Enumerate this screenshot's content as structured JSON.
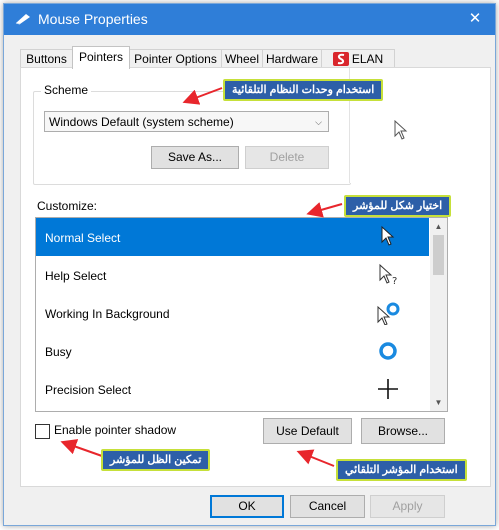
{
  "window": {
    "title": "Mouse Properties",
    "close_glyph": "✕"
  },
  "tabs": [
    {
      "label": "Buttons"
    },
    {
      "label": "Pointers"
    },
    {
      "label": "Pointer Options"
    },
    {
      "label": "Wheel"
    },
    {
      "label": "Hardware"
    },
    {
      "label": "ELAN"
    }
  ],
  "scheme": {
    "label": "Scheme",
    "value": "Windows Default (system scheme)",
    "save_as_label": "Save As...",
    "delete_label": "Delete"
  },
  "customize": {
    "label": "Customize:",
    "items": [
      {
        "label": "Normal Select",
        "icon": "arrow-cursor-icon",
        "selected": true
      },
      {
        "label": "Help Select",
        "icon": "help-cursor-icon"
      },
      {
        "label": "Working In Background",
        "icon": "working-cursor-icon"
      },
      {
        "label": "Busy",
        "icon": "busy-cursor-icon"
      },
      {
        "label": "Precision Select",
        "icon": "crosshair-cursor-icon"
      }
    ]
  },
  "shadow": {
    "label": "Enable pointer shadow",
    "checked": false
  },
  "buttons": {
    "use_default": "Use Default",
    "browse": "Browse...",
    "ok": "OK",
    "cancel": "Cancel",
    "apply": "Apply"
  },
  "annotations": {
    "scheme": "استخدام وحدات النظام التلقائية",
    "customize": "اختيار شكل للمؤشر",
    "shadow": "تمكين الظل للمؤشر",
    "use_default": "استخدام المؤشر التلقائي"
  },
  "colors": {
    "accent": "#0078d7",
    "annotation_bg": "#2d5fa8",
    "annotation_border": "#c6e03a",
    "arrow": "#e8262c"
  }
}
